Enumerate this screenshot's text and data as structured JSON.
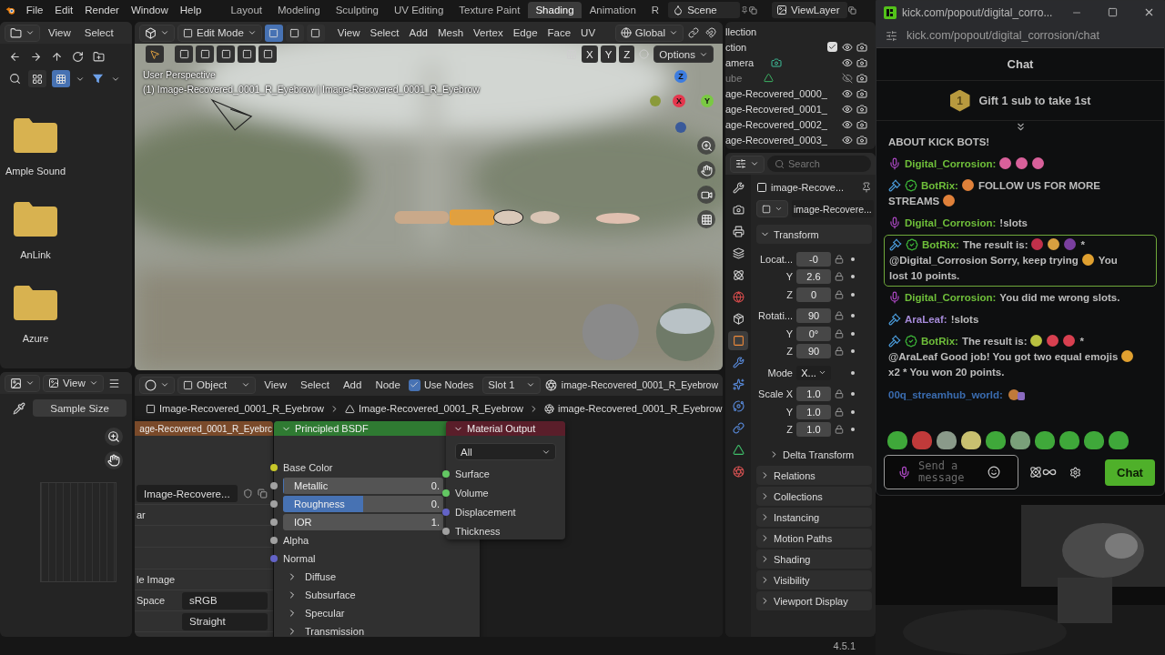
{
  "menubar": {
    "menus": [
      "File",
      "Edit",
      "Render",
      "Window",
      "Help"
    ],
    "workspaces": [
      {
        "label": "Layout",
        "selected": false
      },
      {
        "label": "Modeling",
        "selected": false
      },
      {
        "label": "Sculpting",
        "selected": false
      },
      {
        "label": "UV Editing",
        "selected": false
      },
      {
        "label": "Texture Paint",
        "selected": false
      },
      {
        "label": "Shading",
        "selected": true
      },
      {
        "label": "Animation",
        "selected": false
      },
      {
        "label": "R",
        "selected": false
      }
    ],
    "scene": "Scene",
    "view_layer": "ViewLayer"
  },
  "file_browser": {
    "menus": [
      "View",
      "Select"
    ],
    "folders": [
      "Ample Sound",
      "AnLink",
      "Azure"
    ]
  },
  "image_editor": {
    "menu": "View",
    "tool_setting": "Sample Size"
  },
  "viewport": {
    "mode": "Edit Mode",
    "select_modes": [
      {
        "selected": true
      },
      {
        "selected": false
      },
      {
        "selected": false
      }
    ],
    "menus": [
      "View",
      "Select",
      "Add",
      "Mesh",
      "Vertex",
      "Edge",
      "Face",
      "UV"
    ],
    "orientation": "Global",
    "axes": [
      "X",
      "Y",
      "Z"
    ],
    "options": "Options",
    "overlay_lines": [
      "User Perspective",
      "(1) Image-Recovered_0001_R_Eyebrow | Image-Recovered_0001_R_Eyebrow"
    ],
    "gizmo": [
      {
        "label": "Z",
        "color": "#3d7de0"
      },
      {
        "label": "X",
        "color": "#e5374d"
      },
      {
        "label": "Y",
        "color": "#7ac943"
      }
    ]
  },
  "node_editor": {
    "type": "Object",
    "menus": [
      "View",
      "Select",
      "Add",
      "Node"
    ],
    "use_nodes": {
      "label": "Use Nodes",
      "checked": true
    },
    "slot": "Slot 1",
    "material": "image-Recovered_0001_R_Eyebrow",
    "breadcrumbs": [
      "Image-Recovered_0001_R_Eyebrow",
      "Image-Recovered_0001_R_Eyebrow",
      "image-Recovered_0001_R_Eyebrow"
    ],
    "image_node": {
      "title": "age-Recovered_0001_R_Eyebrc",
      "image": "Image-Recovere...",
      "label": "ar",
      "source": "le Image",
      "space_label": "Space",
      "space": "sRGB",
      "alpha": "Straight"
    },
    "bsdf": {
      "title": "Principled BSDF",
      "inputs": [
        {
          "kind": "socket",
          "label": "Base Color",
          "color": "#c7c729"
        },
        {
          "kind": "slider",
          "label": "Metallic",
          "value": "0.",
          "level": 0,
          "color": "#a1a1a1"
        },
        {
          "kind": "slider",
          "label": "Roughness",
          "value": "0.",
          "level": 0.5,
          "color": "#a1a1a1"
        },
        {
          "kind": "number",
          "label": "IOR",
          "value": "1.",
          "color": "#a1a1a1"
        },
        {
          "kind": "socket",
          "label": "Alpha",
          "color": "#a1a1a1"
        },
        {
          "kind": "socket",
          "label": "Normal",
          "color": "#6363c7"
        },
        {
          "kind": "panel",
          "label": "Diffuse"
        },
        {
          "kind": "panel",
          "label": "Subsurface"
        },
        {
          "kind": "panel",
          "label": "Specular"
        },
        {
          "kind": "panel",
          "label": "Transmission"
        }
      ]
    },
    "output": {
      "title": "Material Output",
      "target": "All",
      "inputs": [
        {
          "label": "Surface",
          "color": "#63c763"
        },
        {
          "label": "Volume",
          "color": "#63c763"
        },
        {
          "label": "Displacement",
          "color": "#6363c7"
        },
        {
          "label": "Thickness",
          "color": "#a1a1a1"
        }
      ]
    }
  },
  "outliner": {
    "root": "llection",
    "rows": [
      {
        "label": "ction",
        "kind": "collection",
        "checked": true,
        "visible": true
      },
      {
        "label": "amera",
        "kind": "camera",
        "visible": true
      },
      {
        "label": "ube",
        "kind": "mesh",
        "visible": false
      },
      {
        "label": "age-Recovered_0000_",
        "kind": "object",
        "visible": true
      },
      {
        "label": "age-Recovered_0001_",
        "kind": "object",
        "visible": true
      },
      {
        "label": "age-Recovered_0002_",
        "kind": "object",
        "visible": true
      },
      {
        "label": "age-Recovered_0003_",
        "kind": "object",
        "visible": true
      }
    ]
  },
  "properties": {
    "search": {
      "placeholder": "Search"
    },
    "tabs": [
      {
        "kind": "tool",
        "selected": false
      },
      {
        "kind": "render",
        "selected": false
      },
      {
        "kind": "output",
        "selected": false
      },
      {
        "kind": "view_layer",
        "selected": false
      },
      {
        "kind": "scene",
        "selected": false
      },
      {
        "kind": "world",
        "selected": false
      },
      {
        "kind": "collection",
        "selected": false
      },
      {
        "kind": "object",
        "selected": true
      },
      {
        "kind": "modifiers",
        "selected": false
      },
      {
        "kind": "particles",
        "selected": false
      },
      {
        "kind": "physics",
        "selected": false
      },
      {
        "kind": "constraints",
        "selected": false
      },
      {
        "kind": "data",
        "selected": false
      },
      {
        "kind": "material",
        "selected": false
      }
    ],
    "object": "image-Recove...",
    "data": "image-Recovere...",
    "transform": {
      "label": "Transform",
      "expanded": true,
      "rows": [
        {
          "label": "Locat...",
          "value": "-0",
          "kind": "number"
        },
        {
          "label": "Y",
          "value": "2.6",
          "kind": "number"
        },
        {
          "label": "Z",
          "value": "0",
          "kind": "number"
        },
        {
          "label": "Rotati...",
          "value": "90",
          "kind": "number"
        },
        {
          "label": "Y",
          "value": "0°",
          "kind": "number"
        },
        {
          "label": "Z",
          "value": "90",
          "kind": "number"
        },
        {
          "label": "Mode",
          "value": "X...",
          "kind": "enum"
        },
        {
          "label": "Scale X",
          "value": "1.0",
          "kind": "number"
        },
        {
          "label": "Y",
          "value": "1.0",
          "kind": "number"
        },
        {
          "label": "Z",
          "value": "1.0",
          "kind": "number"
        }
      ],
      "sub": {
        "label": "Delta Transform",
        "expanded": false
      }
    },
    "panels": [
      {
        "label": "Relations",
        "expanded": false
      },
      {
        "label": "Collections",
        "expanded": false
      },
      {
        "label": "Instancing",
        "expanded": false
      },
      {
        "label": "Motion Paths",
        "expanded": false
      },
      {
        "label": "Shading",
        "expanded": false
      },
      {
        "label": "Visibility",
        "expanded": false
      },
      {
        "label": "Viewport Display",
        "expanded": false
      }
    ]
  },
  "status": {
    "version": "4.5.1"
  },
  "chat": {
    "window_title": "kick.com/popout/digital_corro...",
    "url": "kick.com/popout/digital_corrosion/chat",
    "title": "Chat",
    "pinned": {
      "rank": "1",
      "text": "Gift 1 sub to take 1st"
    },
    "messages": [
      {
        "highlighted": false,
        "parts": [
          {
            "kind": "text",
            "text": "ABOUT KICK BOTS!"
          }
        ]
      },
      {
        "user": "Digital_Corrosion:",
        "color": "#6fbf3a",
        "badges": [
          {
            "kind": "mic"
          }
        ],
        "highlighted": false,
        "parts": [
          {
            "kind": "emoji",
            "color": "#d8609a"
          },
          {
            "kind": "emoji",
            "color": "#d8609a"
          },
          {
            "kind": "emoji",
            "color": "#d8609a"
          }
        ]
      },
      {
        "user": "BotRix:",
        "color": "#6fbf3a",
        "badges": [
          {
            "kind": "mod"
          },
          {
            "kind": "verified"
          }
        ],
        "highlighted": false,
        "parts": [
          {
            "kind": "emoji",
            "color": "#e0813a"
          },
          {
            "kind": "text",
            "text": "FOLLOW US FOR MORE"
          },
          {
            "kind": "text",
            "text": "STREAMS"
          },
          {
            "kind": "emoji",
            "color": "#e0813a"
          }
        ]
      },
      {
        "user": "Digital_Corrosion:",
        "color": "#6fbf3a",
        "badges": [
          {
            "kind": "mic"
          }
        ],
        "highlighted": false,
        "parts": [
          {
            "kind": "text",
            "text": "!slots"
          }
        ]
      },
      {
        "user": "BotRix:",
        "color": "#6fbf3a",
        "badges": [
          {
            "kind": "mod"
          },
          {
            "kind": "verified"
          }
        ],
        "highlighted": true,
        "parts": [
          {
            "kind": "text",
            "text": "The result is:"
          },
          {
            "kind": "emoji",
            "color": "#c0304a"
          },
          {
            "kind": "emoji",
            "color": "#d8a040"
          },
          {
            "kind": "emoji",
            "color": "#7a3fa0"
          },
          {
            "kind": "text",
            "text": "*"
          },
          {
            "kind": "text",
            "text": "@Digital_Corrosion Sorry, keep trying"
          },
          {
            "kind": "emoji",
            "color": "#e0a030"
          },
          {
            "kind": "text",
            "text": "You"
          },
          {
            "kind": "text",
            "text": "lost 10 points."
          }
        ]
      },
      {
        "user": "Digital_Corrosion:",
        "color": "#6fbf3a",
        "badges": [
          {
            "kind": "mic"
          }
        ],
        "highlighted": false,
        "parts": [
          {
            "kind": "text",
            "text": "You did me wrong slots."
          }
        ]
      },
      {
        "user": "AraLeaf:",
        "color": "#a58ad8",
        "badges": [
          {
            "kind": "mod"
          }
        ],
        "highlighted": false,
        "parts": [
          {
            "kind": "text",
            "text": "!slots"
          }
        ]
      },
      {
        "user": "BotRix:",
        "color": "#6fbf3a",
        "badges": [
          {
            "kind": "mod"
          },
          {
            "kind": "verified"
          }
        ],
        "highlighted": false,
        "parts": [
          {
            "kind": "text",
            "text": "The result is:"
          },
          {
            "kind": "emoji",
            "color": "#b8c040"
          },
          {
            "kind": "emoji",
            "color": "#d84050"
          },
          {
            "kind": "emoji",
            "color": "#d84050"
          },
          {
            "kind": "text",
            "text": "*"
          },
          {
            "kind": "text",
            "text": "@AraLeaf Good job! You got two equal emojis"
          },
          {
            "kind": "emoji",
            "color": "#e0a030"
          },
          {
            "kind": "text",
            "text": "x2 * You won 20 points."
          }
        ]
      },
      {
        "user": "00q_streamhub_world:",
        "color": "#3a6cb0",
        "highlighted": false,
        "parts": [
          {
            "kind": "sticker"
          }
        ]
      }
    ],
    "emotes": [
      {
        "color": "#3fa83a"
      },
      {
        "color": "#c03a3a"
      },
      {
        "color": "#8a9a8a"
      },
      {
        "color": "#c8c070"
      },
      {
        "color": "#3fa83a"
      },
      {
        "color": "#7aa07a"
      },
      {
        "color": "#3fa83a"
      },
      {
        "color": "#3fa83a"
      },
      {
        "color": "#3fa83a"
      },
      {
        "color": "#3fa83a"
      }
    ],
    "input": {
      "placeholder": "Send a message"
    },
    "send": "Chat"
  }
}
